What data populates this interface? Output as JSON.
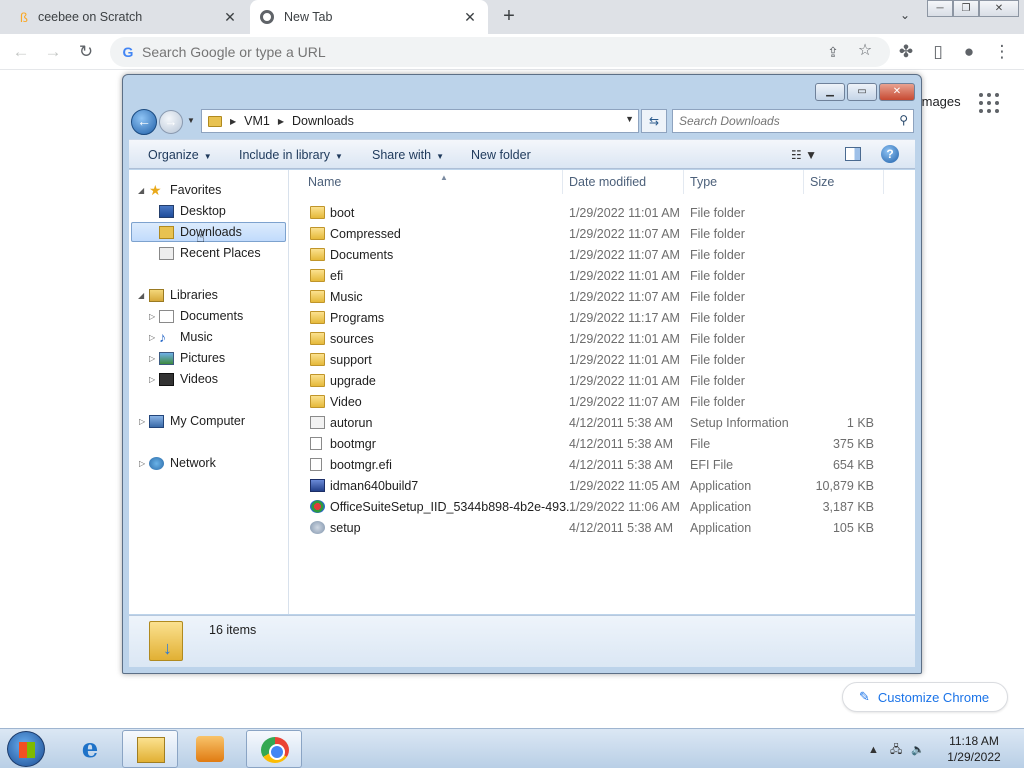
{
  "chrome": {
    "tabs": [
      {
        "title": "ceebee on Scratch",
        "icon": "scratch-favicon"
      },
      {
        "title": "New Tab",
        "icon": "chrome-favicon"
      }
    ],
    "omnibox_placeholder": "Search Google or type a URL",
    "images_link": "Images",
    "customize_label": "Customize Chrome"
  },
  "explorer": {
    "breadcrumb": [
      "VM1",
      "Downloads"
    ],
    "search_placeholder": "Search Downloads",
    "commands": {
      "organize": "Organize",
      "include": "Include in library",
      "share": "Share with",
      "new_folder": "New folder"
    },
    "nav": {
      "favorites": "Favorites",
      "desktop": "Desktop",
      "downloads": "Downloads",
      "recent": "Recent Places",
      "libraries": "Libraries",
      "documents": "Documents",
      "music": "Music",
      "pictures": "Pictures",
      "videos": "Videos",
      "computer": "My Computer",
      "network": "Network"
    },
    "columns": {
      "name": "Name",
      "date": "Date modified",
      "type": "Type",
      "size": "Size"
    },
    "files": [
      {
        "name": "boot",
        "date": "1/29/2022 11:01 AM",
        "type": "File folder",
        "size": "",
        "icon": "folder"
      },
      {
        "name": "Compressed",
        "date": "1/29/2022 11:07 AM",
        "type": "File folder",
        "size": "",
        "icon": "folder"
      },
      {
        "name": "Documents",
        "date": "1/29/2022 11:07 AM",
        "type": "File folder",
        "size": "",
        "icon": "folder"
      },
      {
        "name": "efi",
        "date": "1/29/2022 11:01 AM",
        "type": "File folder",
        "size": "",
        "icon": "folder"
      },
      {
        "name": "Music",
        "date": "1/29/2022 11:07 AM",
        "type": "File folder",
        "size": "",
        "icon": "folder"
      },
      {
        "name": "Programs",
        "date": "1/29/2022 11:17 AM",
        "type": "File folder",
        "size": "",
        "icon": "folder"
      },
      {
        "name": "sources",
        "date": "1/29/2022 11:01 AM",
        "type": "File folder",
        "size": "",
        "icon": "folder"
      },
      {
        "name": "support",
        "date": "1/29/2022 11:01 AM",
        "type": "File folder",
        "size": "",
        "icon": "folder"
      },
      {
        "name": "upgrade",
        "date": "1/29/2022 11:01 AM",
        "type": "File folder",
        "size": "",
        "icon": "folder"
      },
      {
        "name": "Video",
        "date": "1/29/2022 11:07 AM",
        "type": "File folder",
        "size": "",
        "icon": "folder"
      },
      {
        "name": "autorun",
        "date": "4/12/2011 5:38 AM",
        "type": "Setup Information",
        "size": "1 KB",
        "icon": "inf"
      },
      {
        "name": "bootmgr",
        "date": "4/12/2011 5:38 AM",
        "type": "File",
        "size": "375 KB",
        "icon": "file"
      },
      {
        "name": "bootmgr.efi",
        "date": "4/12/2011 5:38 AM",
        "type": "EFI File",
        "size": "654 KB",
        "icon": "file"
      },
      {
        "name": "idman640build7",
        "date": "1/29/2022 11:05 AM",
        "type": "Application",
        "size": "10,879 KB",
        "icon": "app"
      },
      {
        "name": "OfficeSuiteSetup_IID_5344b898-4b2e-493...",
        "date": "1/29/2022 11:06 AM",
        "type": "Application",
        "size": "3,187 KB",
        "icon": "office"
      },
      {
        "name": "setup",
        "date": "4/12/2011 5:38 AM",
        "type": "Application",
        "size": "105 KB",
        "icon": "setup"
      }
    ],
    "item_count": "16 items"
  },
  "taskbar": {
    "time": "11:18 AM",
    "date": "1/29/2022"
  }
}
